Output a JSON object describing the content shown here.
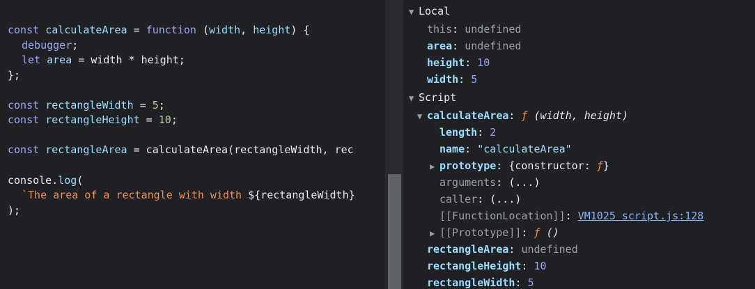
{
  "editor": {
    "l1": {
      "const": "const",
      "name": "calculateArea",
      "eq": " = ",
      "fnkw": "function",
      "open": " (",
      "p1": "width",
      "comma": ", ",
      "p2": "height",
      "close": ") {"
    },
    "l2": {
      "text": "debugger",
      "semi": ";"
    },
    "l3": {
      "let": "let",
      "name": "area",
      "rest": " = width * height;"
    },
    "l4": {
      "text": "};"
    },
    "l5": {
      "const": "const",
      "name": "rectangleWidth",
      "eq": " = ",
      "val": "5",
      "semi": ";"
    },
    "l6": {
      "const": "const",
      "name": "rectangleHeight",
      "eq": " = ",
      "val": "10",
      "semi": ";"
    },
    "l7": {
      "const": "const",
      "name": "rectangleArea",
      "rest": " = calculateArea(rectangleWidth, rec"
    },
    "l8": {
      "obj": "console",
      "dot": ".",
      "method": "log",
      "open": "("
    },
    "l9": {
      "str": "`The area of a rectangle with width ",
      "interp": "${rectangleWidth}"
    },
    "l10": {
      "text": ");"
    }
  },
  "scope": {
    "local": {
      "label": "Local",
      "this": {
        "name": "this",
        "sep": ": ",
        "value": "undefined"
      },
      "area": {
        "name": "area",
        "sep": ": ",
        "value": "undefined"
      },
      "height": {
        "name": "height",
        "sep": ": ",
        "value": "10"
      },
      "width": {
        "name": "width",
        "sep": ": ",
        "value": "5"
      }
    },
    "script": {
      "label": "Script",
      "calculateArea": {
        "name": "calculateArea",
        "sep": ": ",
        "f": "ƒ",
        "sig": " (width, height)"
      },
      "length": {
        "name": "length",
        "sep": ": ",
        "value": "2"
      },
      "fname": {
        "name": "name",
        "sep": ": ",
        "value": "\"calculateArea\""
      },
      "prototype": {
        "name": "prototype",
        "sep": ": ",
        "value_open": "{constructor: ",
        "f": "ƒ",
        "value_close": "}"
      },
      "arguments": {
        "name": "arguments",
        "sep": ": ",
        "value": "(...)"
      },
      "caller": {
        "name": "caller",
        "sep": ": ",
        "value": "(...)"
      },
      "floc": {
        "name": "[[FunctionLocation]]",
        "sep": ": ",
        "value": "VM1025 script.js:128"
      },
      "proto": {
        "name": "[[Prototype]]",
        "sep": ": ",
        "f": "ƒ",
        "sig": " ()"
      },
      "rectangleArea": {
        "name": "rectangleArea",
        "sep": ": ",
        "value": "undefined"
      },
      "rectangleHeight": {
        "name": "rectangleHeight",
        "sep": ": ",
        "value": "10"
      },
      "rectangleWidth": {
        "name": "rectangleWidth",
        "sep": ": ",
        "value": "5"
      }
    }
  }
}
